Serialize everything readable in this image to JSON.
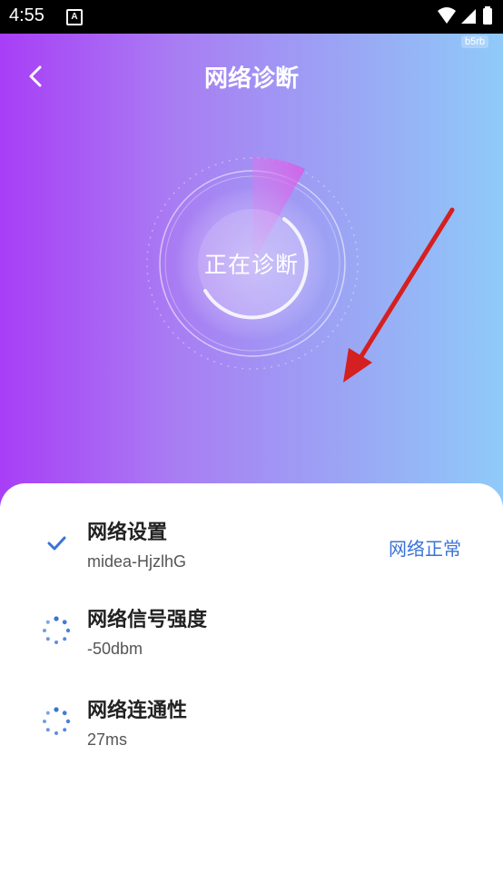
{
  "status_bar": {
    "time": "4:55",
    "notification_icon": "A"
  },
  "watermark": "b5rb",
  "header": {
    "title": "网络诊断"
  },
  "radar": {
    "label": "正在诊断"
  },
  "items": [
    {
      "title": "网络设置",
      "subtitle": "midea-HjzlhG",
      "status": "网络正常",
      "icon": "check-icon"
    },
    {
      "title": "网络信号强度",
      "subtitle": "-50dbm",
      "status": "",
      "icon": "loading-spinner-icon"
    },
    {
      "title": "网络连通性",
      "subtitle": "27ms",
      "status": "",
      "icon": "loading-spinner-icon"
    }
  ],
  "colors": {
    "accent": "#3a73d6",
    "gradient_start": "#a83ef6",
    "gradient_end": "#8fcaf9",
    "arrow": "#d42020"
  }
}
